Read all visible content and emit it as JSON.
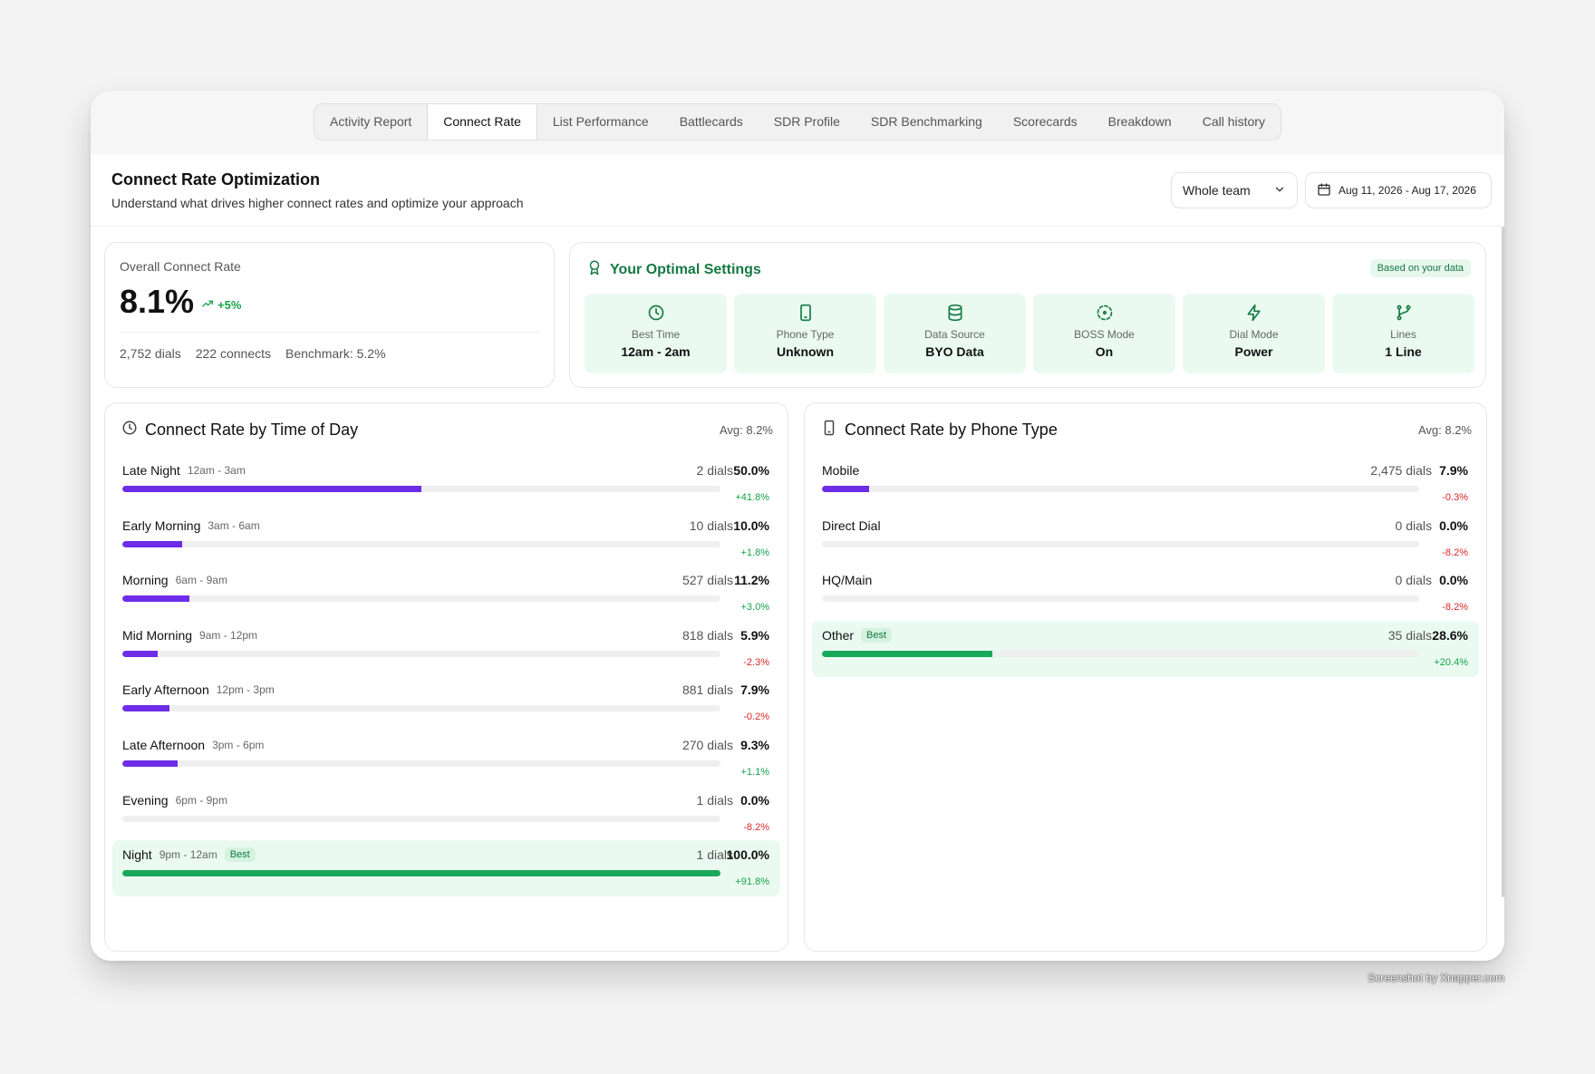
{
  "tabs": [
    {
      "label": "Activity Report",
      "active": false
    },
    {
      "label": "Connect Rate",
      "active": true
    },
    {
      "label": "List Performance",
      "active": false
    },
    {
      "label": "Battlecards",
      "active": false
    },
    {
      "label": "SDR Profile",
      "active": false
    },
    {
      "label": "SDR Benchmarking",
      "active": false
    },
    {
      "label": "Scorecards",
      "active": false
    },
    {
      "label": "Breakdown",
      "active": false
    },
    {
      "label": "Call history",
      "active": false
    }
  ],
  "header": {
    "title": "Connect Rate Optimization",
    "subtitle": "Understand what drives higher connect rates and optimize your approach",
    "team_select": "Whole team",
    "date_range": "Aug 11, 2026 - Aug 17, 2026"
  },
  "overall": {
    "label": "Overall Connect Rate",
    "value": "8.1%",
    "delta": "+5%",
    "dials": "2,752 dials",
    "connects": "222 connects",
    "benchmark": "Benchmark: 5.2%"
  },
  "optimal": {
    "title": "Your Optimal Settings",
    "badge": "Based on your data",
    "settings": [
      {
        "label": "Best Time",
        "value": "12am - 2am",
        "icon": "clock-icon"
      },
      {
        "label": "Phone Type",
        "value": "Unknown",
        "icon": "phone-icon"
      },
      {
        "label": "Data Source",
        "value": "BYO Data",
        "icon": "database-icon"
      },
      {
        "label": "BOSS Mode",
        "value": "On",
        "icon": "dashed-circle-icon"
      },
      {
        "label": "Dial Mode",
        "value": "Power",
        "icon": "lightning-icon"
      },
      {
        "label": "Lines",
        "value": "1 Line",
        "icon": "branch-icon"
      }
    ]
  },
  "time_of_day": {
    "title": "Connect Rate by Time of Day",
    "avg": "Avg: 8.2%",
    "rows": [
      {
        "name": "Late Night",
        "range": "12am - 3am",
        "dials": "2 dials",
        "pct": "50.0%",
        "fraction": 0.5,
        "change": "+41.8%",
        "dir": "pos",
        "best": false
      },
      {
        "name": "Early Morning",
        "range": "3am - 6am",
        "dials": "10 dials",
        "pct": "10.0%",
        "fraction": 0.1,
        "change": "+1.8%",
        "dir": "pos",
        "best": false
      },
      {
        "name": "Morning",
        "range": "6am - 9am",
        "dials": "527 dials",
        "pct": "11.2%",
        "fraction": 0.112,
        "change": "+3.0%",
        "dir": "pos",
        "best": false
      },
      {
        "name": "Mid Morning",
        "range": "9am - 12pm",
        "dials": "818 dials",
        "pct": "5.9%",
        "fraction": 0.059,
        "change": "-2.3%",
        "dir": "neg",
        "best": false
      },
      {
        "name": "Early Afternoon",
        "range": "12pm - 3pm",
        "dials": "881 dials",
        "pct": "7.9%",
        "fraction": 0.079,
        "change": "-0.2%",
        "dir": "neg",
        "best": false
      },
      {
        "name": "Late Afternoon",
        "range": "3pm - 6pm",
        "dials": "270 dials",
        "pct": "9.3%",
        "fraction": 0.093,
        "change": "+1.1%",
        "dir": "pos",
        "best": false
      },
      {
        "name": "Evening",
        "range": "6pm - 9pm",
        "dials": "1 dials",
        "pct": "0.0%",
        "fraction": 0.0,
        "change": "-8.2%",
        "dir": "neg",
        "best": false
      },
      {
        "name": "Night",
        "range": "9pm - 12am",
        "dials": "1 dials",
        "pct": "100.0%",
        "fraction": 1.0,
        "change": "+91.8%",
        "dir": "pos",
        "best": true,
        "best_label": "Best"
      }
    ]
  },
  "phone_type": {
    "title": "Connect Rate by Phone Type",
    "avg": "Avg: 8.2%",
    "rows": [
      {
        "name": "Mobile",
        "range": "",
        "dials": "2,475 dials",
        "pct": "7.9%",
        "fraction": 0.079,
        "change": "-0.3%",
        "dir": "neg",
        "best": false
      },
      {
        "name": "Direct Dial",
        "range": "",
        "dials": "0 dials",
        "pct": "0.0%",
        "fraction": 0.0,
        "change": "-8.2%",
        "dir": "neg",
        "best": false
      },
      {
        "name": "HQ/Main",
        "range": "",
        "dials": "0 dials",
        "pct": "0.0%",
        "fraction": 0.0,
        "change": "-8.2%",
        "dir": "neg",
        "best": false
      },
      {
        "name": "Other",
        "range": "",
        "dials": "35 dials",
        "pct": "28.6%",
        "fraction": 0.286,
        "change": "+20.4%",
        "dir": "pos",
        "best": true,
        "best_label": "Best"
      }
    ]
  },
  "credit": "Screenshot by Xnapper.com"
}
